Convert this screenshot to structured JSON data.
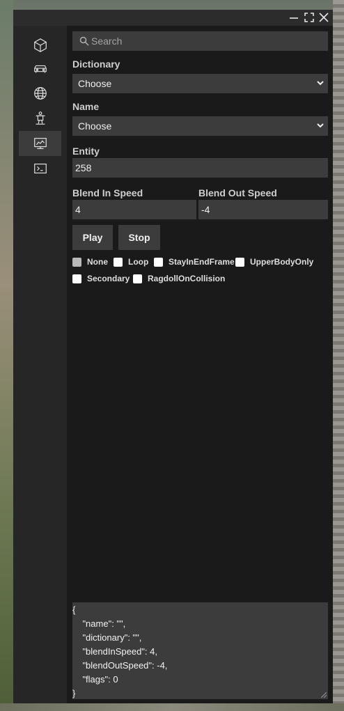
{
  "titlebar": {
    "minimize_icon": "minimize-icon",
    "maximize_icon": "maximize-icon",
    "close_icon": "close-icon"
  },
  "sidebar": {
    "items": [
      {
        "icon": "cube-icon",
        "active": false
      },
      {
        "icon": "car-icon",
        "active": false
      },
      {
        "icon": "globe-icon",
        "active": false
      },
      {
        "icon": "person-icon",
        "active": false
      },
      {
        "icon": "animation-icon",
        "active": true
      },
      {
        "icon": "terminal-icon",
        "active": false
      }
    ]
  },
  "search": {
    "placeholder": "Search"
  },
  "dictionary": {
    "label": "Dictionary",
    "value": "Choose"
  },
  "name": {
    "label": "Name",
    "value": "Choose"
  },
  "entity": {
    "label": "Entity",
    "value": "258"
  },
  "blend_in": {
    "label": "Blend In Speed",
    "value": "4"
  },
  "blend_out": {
    "label": "Blend Out Speed",
    "value": "-4"
  },
  "buttons": {
    "play": "Play",
    "stop": "Stop"
  },
  "flags": [
    {
      "label": "None",
      "checked": false,
      "disabled": true
    },
    {
      "label": "Loop",
      "checked": false
    },
    {
      "label": "StayInEndFrame",
      "checked": false
    },
    {
      "label": "UpperBodyOnly",
      "checked": false
    },
    {
      "label": "Secondary",
      "checked": false
    },
    {
      "label": "RagdollOnCollision",
      "checked": false
    }
  ],
  "json_output": {
    "lines": [
      "{",
      "    \"name\": \"\",",
      "    \"dictionary\": \"\",",
      "    \"blendInSpeed\": 4,",
      "    \"blendOutSpeed\": -4,",
      "    \"flags\": 0",
      "}"
    ]
  },
  "colors": {
    "panel": "#1a1a1a",
    "sidebar": "#262626",
    "field": "#3c3c3c",
    "titlebar": "#2c2c2c"
  }
}
